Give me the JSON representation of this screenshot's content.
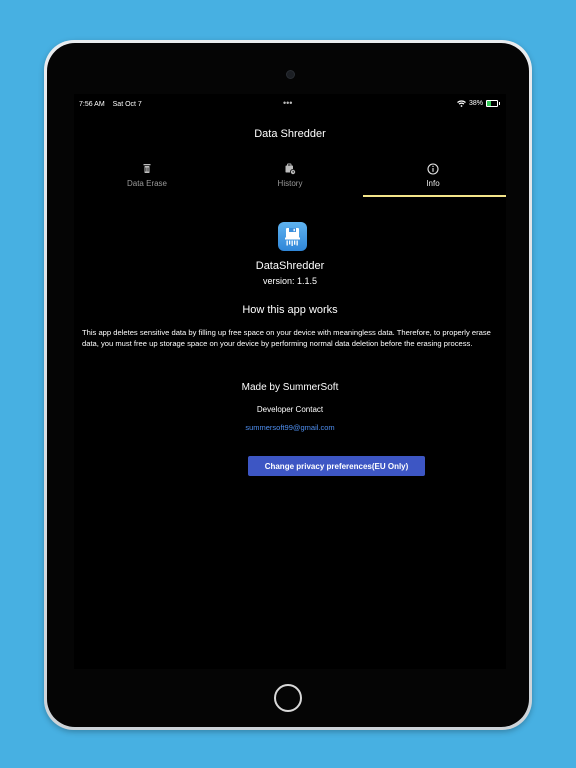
{
  "status_bar": {
    "time": "7:56 AM",
    "date": "Sat Oct 7",
    "multitask_dots": "•••",
    "battery_percent": "38%",
    "battery_level": 0.38,
    "wifi_icon": "wifi-icon",
    "battery_icon": "battery-charging-icon"
  },
  "nav": {
    "title": "Data Shredder"
  },
  "tabs": [
    {
      "label": "Data Erase",
      "icon": "trash-icon",
      "active": false
    },
    {
      "label": "History",
      "icon": "history-icon",
      "active": false
    },
    {
      "label": "Info",
      "icon": "info-icon",
      "active": true
    }
  ],
  "info": {
    "app_icon": "shredder-app-icon",
    "app_name": "DataShredder",
    "version": "version: 1.1.5",
    "how_title": "How this app works",
    "description": "This app deletes sensitive data by filling up free space on your device with meaningless data. Therefore, to properly erase data, you must free up storage space on your device by performing normal data deletion before the erasing process.",
    "made_by": "Made by SummerSoft",
    "developer_contact": "Developer Contact",
    "email": "summersoft99@gmail.com",
    "privacy_button": "Change privacy preferences(EU Only)"
  },
  "colors": {
    "background": "#47b0e2",
    "screen": "#000000",
    "tab_indicator": "#f3e48a",
    "link": "#4f8ff0",
    "button": "#3d56c4",
    "battery_fill": "#34c759"
  }
}
